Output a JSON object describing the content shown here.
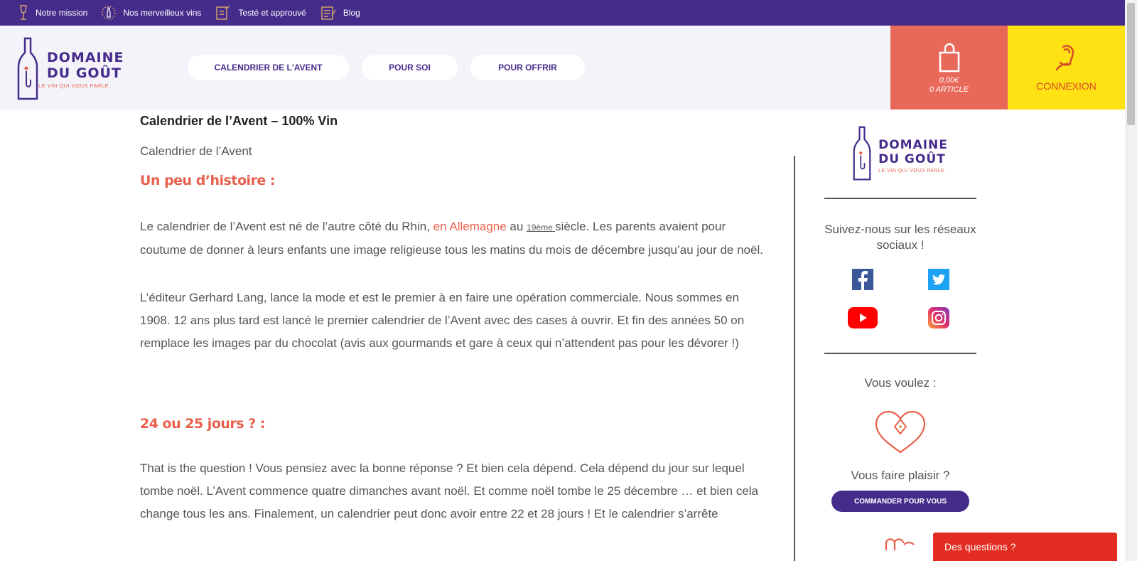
{
  "topbar": {
    "items": [
      {
        "label": "Notre mission",
        "icon": "wine-glass-icon"
      },
      {
        "label": "Nos merveilleux vins",
        "icon": "award-bottle-icon"
      },
      {
        "label": "Testé et approuvé",
        "icon": "tasting-icon"
      },
      {
        "label": "Blog",
        "icon": "notepad-icon"
      }
    ]
  },
  "logo": {
    "line1": "DOMAINE",
    "line2": "DU GOÛT",
    "tagline": "LE VIN QUI VOUS PARLE"
  },
  "nav": {
    "items": [
      "CALENDRIER DE L'AVENT",
      "POUR SOI",
      "POUR OFFRIR"
    ]
  },
  "cart": {
    "amount": "0,00€",
    "count": "0 ARTICLE"
  },
  "login": {
    "label": "CONNEXION"
  },
  "article": {
    "title": "Calendrier de l’Avent – 100% Vin",
    "subtitle": "Calendrier de l’Avent",
    "section1_heading": "Un peu d’histoire :",
    "p1_a": "Le calendrier de l’Avent est né de l’autre côté du Rhin, ",
    "p1_link": "en Allemagne",
    "p1_b": " au ",
    "p1_sup": "19ème ",
    "p1_c": "siècle. Les parents avaient pour coutume de donner à leurs enfants une image religieuse tous les matins du mois de décembre jusqu’au jour de noël.",
    "p2": "L’éditeur Gerhard Lang, lance la mode et est le premier à en faire une opération commerciale. Nous sommes en 1908. 12 ans plus tard est lancé le premier calendrier de l’Avent avec des cases à ouvrir. Et fin des années 50 on remplace les images par du chocolat (avis aux gourmands et gare à ceux qui n’attendent pas pour les dévorer !)",
    "section2_heading": "24 ou 25 jours ? :",
    "p3": "That is the question ! Vous pensiez avec la bonne réponse ? Et bien cela dépend. Cela dépend du jour sur lequel tombe noël. L’Avent commence quatre dimanches avant noël. Et comme noël tombe le 25 décembre … et bien cela change tous les ans. Finalement, un calendrier peut donc avoir entre 22 et 28 jours ! Et le calendrier s’arrête"
  },
  "sidebar": {
    "follow_text": "Suivez-nous sur les réseaux sociaux !",
    "social": [
      "facebook-icon",
      "twitter-icon",
      "youtube-icon",
      "instagram-icon"
    ],
    "want_text": "Vous voulez :",
    "pleasure_text": "Vous faire plaisir ?",
    "order_button": "COMMANDER POUR VOUS"
  },
  "chat": {
    "label": "Des questions ?"
  },
  "colors": {
    "purple": "#452c8b",
    "coral": "#e8604c",
    "yellow": "#ffe213",
    "red": "#e32d22"
  }
}
